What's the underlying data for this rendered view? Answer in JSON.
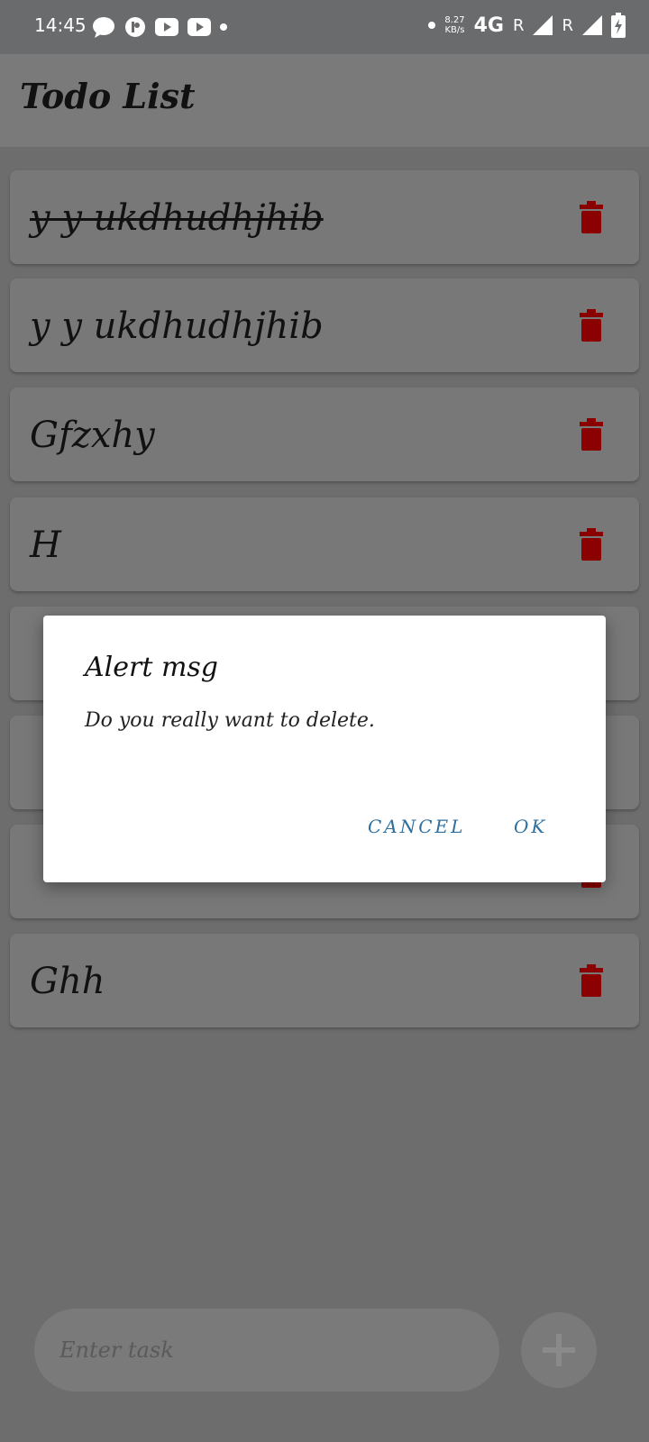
{
  "status_bar": {
    "time": "14:45",
    "speed_top": "8.27",
    "speed_bottom": "KB/s",
    "network": "4G",
    "roaming1": "R",
    "roaming2": "R"
  },
  "app_bar": {
    "title": "Todo List"
  },
  "todos": [
    {
      "text": "y y ukdhudhjhib",
      "done": true
    },
    {
      "text": "y y ukdhudhjhib",
      "done": false
    },
    {
      "text": "Gfzxhy",
      "done": false
    },
    {
      "text": "H",
      "done": false
    },
    {
      "text": "Ghh",
      "done": false
    }
  ],
  "input": {
    "placeholder": "Enter task"
  },
  "dialog": {
    "title": "Alert msg",
    "message": "Do you really want to delete.",
    "cancel_label": "CANCEL",
    "ok_label": "OK"
  },
  "colors": {
    "delete_icon": "#8b0000",
    "dialog_button": "#2e6f9e"
  }
}
